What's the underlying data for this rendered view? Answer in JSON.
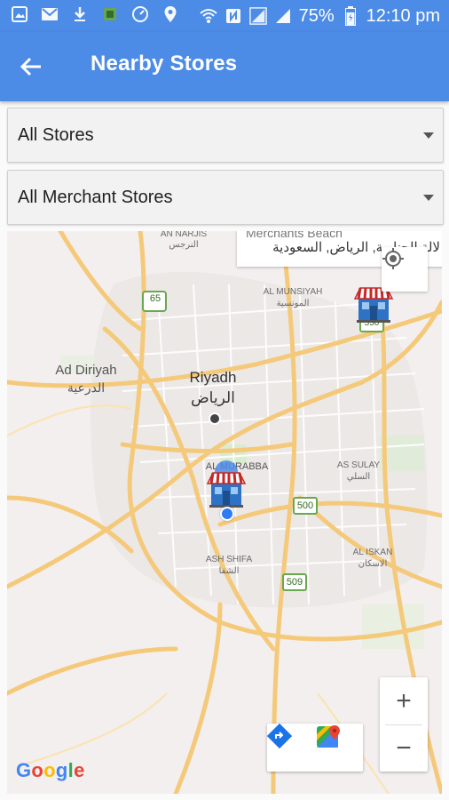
{
  "status_bar": {
    "battery_percent": "75%",
    "time": "12:10 pm",
    "icons_left": [
      "gallery-icon",
      "email-icon",
      "download-icon",
      "app-icon",
      "dashboard-icon",
      "location-icon"
    ],
    "icons_right": [
      "wifi-icon",
      "nfc-icon",
      "signal-icon",
      "signal-icon-2",
      "battery-icon"
    ]
  },
  "app_bar": {
    "title": "Nearby Stores",
    "back_icon": "arrow-left-icon"
  },
  "filters": {
    "store_type": "All Stores",
    "merchant_type": "All Merchant Stores"
  },
  "map": {
    "info_window": {
      "title": "Merchants Beach",
      "address": "لالة الحنارية, الرياض, السعودية"
    },
    "labels": {
      "an_narjis": "AN NARJIS",
      "an_narjis_ar": "النرجس",
      "al_munsiyah": "AL MUNSIYAH",
      "al_munsiyah_ar": "المونسية",
      "ad_diriyah": "Ad Diriyah",
      "ad_diriyah_ar": "الدرعية",
      "riyadh": "Riyadh",
      "riyadh_ar": "الرياض",
      "al_murabba": "AL MURABBA",
      "as_sulay": "AS SULAY",
      "as_sulay_ar": "السلي",
      "al_iskan": "AL ISKAN",
      "al_iskan_ar": "الاسكان",
      "ash_shifa": "ASH SHIFA",
      "ash_shifa_ar": "الشفا"
    },
    "road_shields": [
      "65",
      "550",
      "500",
      "509"
    ],
    "zoom_in": "+",
    "zoom_out": "−",
    "attribution": "Google"
  },
  "colors": {
    "primary": "#4c8be6",
    "road": "#f7d38a",
    "map_bg": "#f3efee"
  }
}
